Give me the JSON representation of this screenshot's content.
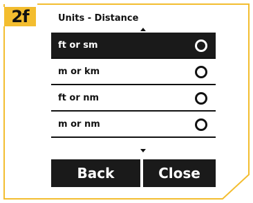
{
  "step_label": "2f",
  "title": "Units - Distance",
  "options": [
    {
      "label": "ft or sm",
      "selected": true
    },
    {
      "label": "m or km",
      "selected": false
    },
    {
      "label": "ft or nm",
      "selected": false
    },
    {
      "label": "m or nm",
      "selected": false
    }
  ],
  "buttons": {
    "back": "Back",
    "close": "Close"
  },
  "colors": {
    "accent": "#f3bd2f",
    "selected_bg": "#1a1a1a",
    "text": "#111111"
  },
  "icons": {
    "scroll_up": "triangle-up-icon",
    "scroll_down": "triangle-down-icon",
    "radio": "radio-circle-icon"
  }
}
